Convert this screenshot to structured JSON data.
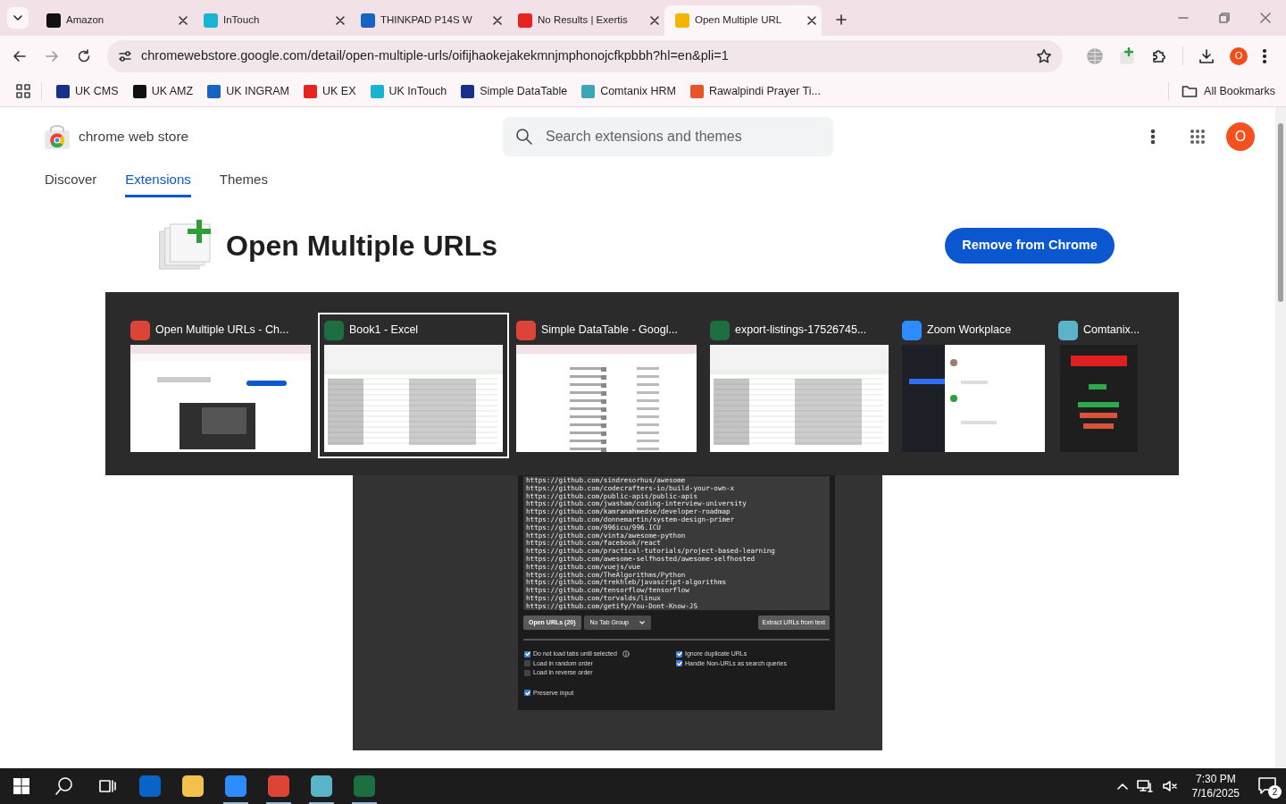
{
  "browser": {
    "tabs": [
      {
        "title": "Amazon",
        "color": "#111111",
        "selected": false
      },
      {
        "title": "InTouch",
        "color": "#19b4d2",
        "selected": false
      },
      {
        "title": "THINKPAD P14S W",
        "color": "#1565c0",
        "selected": false
      },
      {
        "title": "No Results | Exertis",
        "color": "#e52421",
        "selected": false
      },
      {
        "title": "Open Multiple URL",
        "color": "#f4b400",
        "selected": true
      }
    ],
    "address": "chromewebstore.google.com/detail/open-multiple-urls/oifijhaokejakekmnjmphonojcfkpbbh?hl=en&pli=1",
    "profile_initial": "O",
    "bookmarks": [
      {
        "label": "UK CMS",
        "color": "#17308a"
      },
      {
        "label": "UK AMZ",
        "color": "#111111"
      },
      {
        "label": "UK INGRAM",
        "color": "#1565c0"
      },
      {
        "label": "UK EX",
        "color": "#e52421"
      },
      {
        "label": "UK InTouch",
        "color": "#19b4d2"
      },
      {
        "label": "Simple DataTable",
        "color": "#17308a"
      },
      {
        "label": "Comtanix HRM",
        "color": "#3aa6b9"
      },
      {
        "label": "Rawalpindi Prayer Ti...",
        "color": "#e8552a"
      }
    ],
    "all_bookmarks": "All Bookmarks"
  },
  "store": {
    "name": "chrome web store",
    "search_placeholder": "Search extensions and themes",
    "avatar": "O",
    "nav": [
      {
        "label": "Discover",
        "selected": false
      },
      {
        "label": "Extensions",
        "selected": true
      },
      {
        "label": "Themes",
        "selected": false
      }
    ],
    "extension": {
      "title": "Open Multiple URLs",
      "action": "Remove from Chrome"
    },
    "screenshot": {
      "urls": [
        "https://github.com/sindresorhus/awesome",
        "https://github.com/codecrafters-io/build-your-own-x",
        "https://github.com/public-apis/public-apis",
        "https://github.com/jwasham/coding-interview-university",
        "https://github.com/kamranahmedse/developer-roadmap",
        "https://github.com/donnemartin/system-design-primer",
        "https://github.com/996icu/996.ICU",
        "https://github.com/vinta/awesome-python",
        "https://github.com/facebook/react",
        "https://github.com/practical-tutorials/project-based-learning",
        "https://github.com/awesome-selfhosted/awesome-selfhosted",
        "https://github.com/vuejs/vue",
        "https://github.com/TheAlgorithms/Python",
        "https://github.com/trekhleb/javascript-algorithms",
        "https://github.com/tensorflow/tensorflow",
        "https://github.com/torvalds/linux",
        "https://github.com/getify/You-Dont-Know-JS"
      ],
      "open_button": "Open URLs (20)",
      "tab_group": "No Tab Group",
      "extract_button": "Extract URLs from text",
      "options_left": [
        {
          "label": "Do not load tabs until selected",
          "checked": true,
          "info": true
        },
        {
          "label": "Load in random order",
          "checked": false,
          "info": false
        },
        {
          "label": "Load in reverse order",
          "checked": false,
          "info": false
        }
      ],
      "options_right": [
        {
          "label": "Ignore duplicate URLs",
          "checked": true
        },
        {
          "label": "Handle Non-URLs as search queries",
          "checked": true
        }
      ],
      "preserve": {
        "label": "Preserve input",
        "checked": true
      }
    }
  },
  "task_switcher": {
    "windows": [
      {
        "title": "Open Multiple URLs - Ch...",
        "color": "#db4437",
        "kind": "browser",
        "selected": false
      },
      {
        "title": "Book1 - Excel",
        "color": "#1d6f42",
        "kind": "sheet",
        "selected": true
      },
      {
        "title": "Simple DataTable - Googl...",
        "color": "#db4437",
        "kind": "table",
        "selected": false
      },
      {
        "title": "export-listings-17526745...",
        "color": "#1d6f42",
        "kind": "sheet",
        "selected": false
      },
      {
        "title": "Zoom Workplace",
        "color": "#2d8cff",
        "kind": "chat",
        "selected": false
      },
      {
        "title": "Comtanix...",
        "color": "#5ab4c8",
        "kind": "dark",
        "selected": false
      }
    ]
  },
  "taskbar": {
    "apps": [
      {
        "color": "#0a64c8",
        "running": false
      },
      {
        "color": "#f2c14e",
        "running": false
      },
      {
        "color": "#2d8cff",
        "running": true
      },
      {
        "color": "#db4437",
        "running": true
      },
      {
        "color": "#5ab4c8",
        "running": true
      },
      {
        "color": "#1d6f42",
        "running": true
      }
    ],
    "time": "7:30 PM",
    "date": "7/16/2025",
    "notifications": "2"
  }
}
